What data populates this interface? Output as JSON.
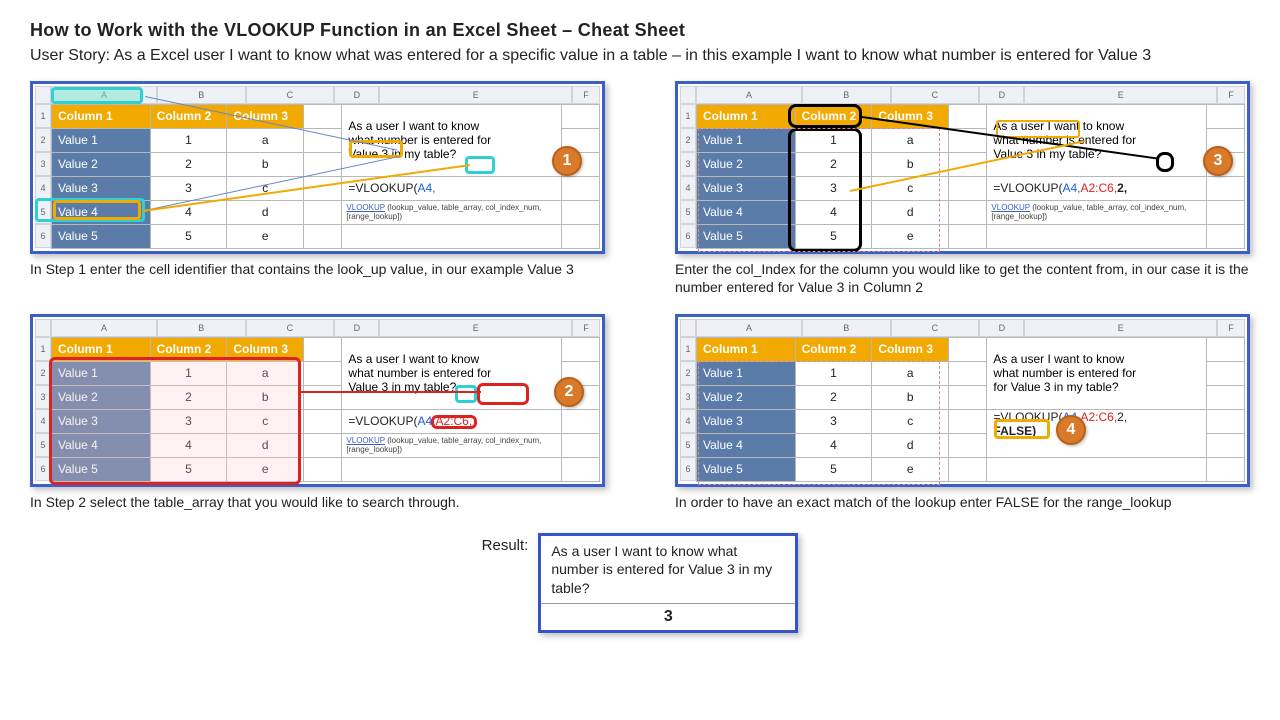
{
  "title": "How to Work with the VLOOKUP Function in an Excel Sheet – Cheat Sheet",
  "user_story": "User Story: As a Excel user I want to know what was entered for a specific value in a table – in this example I want to know what number is entered for Value 3",
  "columns_letters": [
    "A",
    "B",
    "C",
    "D",
    "E",
    "F"
  ],
  "row_numbers": [
    "1",
    "2",
    "3",
    "4",
    "5",
    "6"
  ],
  "table": {
    "headers": [
      "Column 1",
      "Column 2",
      "Column 3"
    ],
    "rows": [
      {
        "c1": "Value 1",
        "c2": "1",
        "c3": "a"
      },
      {
        "c1": "Value 2",
        "c2": "2",
        "c3": "b"
      },
      {
        "c1": "Value 3",
        "c2": "3",
        "c3": "c"
      },
      {
        "c1": "Value 4",
        "c2": "4",
        "c3": "d"
      },
      {
        "c1": "Value 5",
        "c2": "5",
        "c3": "e"
      }
    ]
  },
  "question_text": {
    "l1": "As a user I want to know",
    "l2": "what number is entered for",
    "l3_s1": "Value 3 in my table?",
    "l3_s4": "for Value 3 in my table?"
  },
  "tooltip": {
    "link": "VLOOKUP",
    "rest": " (lookup_value, table_array, col_index_num, [range_lookup])"
  },
  "steps": {
    "s1": {
      "badge": "1",
      "formula_prefix": "=VLOOKUP(",
      "formula_a4": "A4,",
      "caption": "In Step 1 enter the cell identifier that contains the look_up value, in our example Value 3"
    },
    "s2": {
      "badge": "2",
      "formula_prefix": "=VLOOKUP(",
      "formula_a4": "A4,",
      "formula_arr": "A2:C6,",
      "caption": "In Step 2 select the table_array that you would like to search through."
    },
    "s3": {
      "badge": "3",
      "formula_prefix": "=VLOOKUP(",
      "formula_a4": "A4,",
      "formula_arr": "A2:C6,",
      "formula_col": "2,",
      "caption": "Enter the col_Index for the column you would like to get the content from, in our case it is the number entered for Value 3 in Column 2"
    },
    "s4": {
      "badge": "4",
      "formula_l1_prefix": "=VLOOKUP(",
      "formula_l1_a4": "A4,",
      "formula_l1_arr": "A2:C6,",
      "formula_l1_col": "2,",
      "formula_l2": "FALSE)",
      "caption": "In order to have an exact match of the lookup enter FALSE for the range_lookup"
    }
  },
  "result": {
    "label": "Result:",
    "q": "As a user I want to know what number is entered for Value 3 in my table?",
    "answer": "3"
  }
}
